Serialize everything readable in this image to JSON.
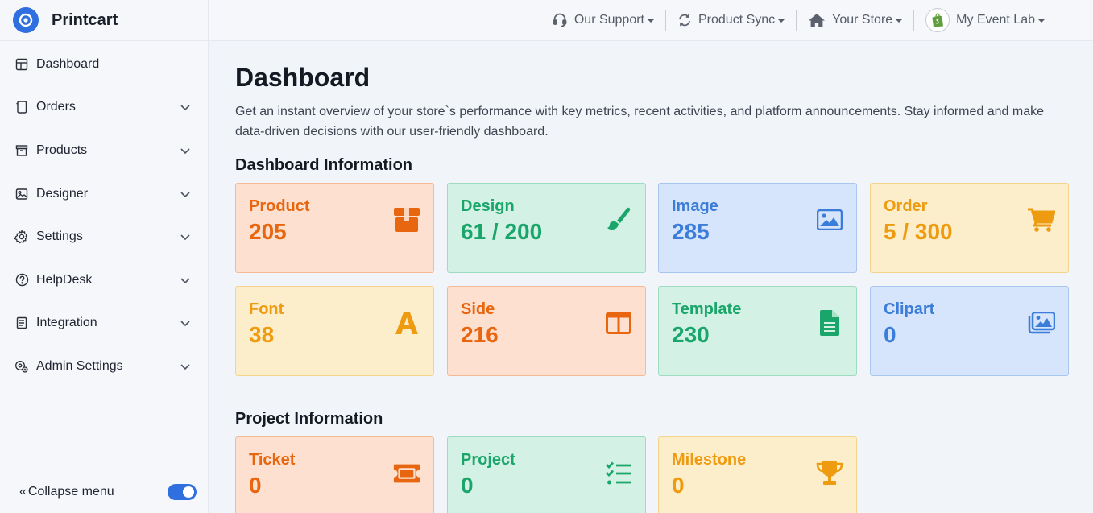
{
  "brand": {
    "name": "Printcart"
  },
  "sidebar": {
    "items": [
      {
        "label": "Dashboard",
        "icon": "layout-icon"
      },
      {
        "label": "Orders",
        "icon": "tablet-icon"
      },
      {
        "label": "Products",
        "icon": "archive-icon"
      },
      {
        "label": "Designer",
        "icon": "image-icon"
      },
      {
        "label": "Settings",
        "icon": "gear-icon"
      },
      {
        "label": "HelpDesk",
        "icon": "question-circle-icon"
      },
      {
        "label": "Integration",
        "icon": "document-icon"
      },
      {
        "label": "Admin Settings",
        "icon": "admin-gear-icon"
      }
    ],
    "collapse_label": "Collapse menu",
    "collapse_prefix": "«"
  },
  "topbar": {
    "support": "Our Support",
    "sync": "Product Sync",
    "store": "Your Store",
    "account": "My Event Lab"
  },
  "main": {
    "title": "Dashboard",
    "description": "Get an instant overview of your store`s performance with key metrics, recent activities, and platform announcements. Stay informed and make data-driven decisions with our user-friendly dashboard.",
    "dashboard_section": "Dashboard Information",
    "project_section": "Project Information",
    "dashboard_cards": [
      {
        "label": "Product",
        "value": "205",
        "icon": "box-icon",
        "color": "#e8660f"
      },
      {
        "label": "Design",
        "value": "61 / 200",
        "icon": "paintbrush-icon",
        "color": "#1aa66a"
      },
      {
        "label": "Image",
        "value": "285",
        "icon": "picture-icon",
        "color": "#3b7dd8"
      },
      {
        "label": "Order",
        "value": "5 / 300",
        "icon": "cart-icon",
        "color": "#ee9b10"
      },
      {
        "label": "Font",
        "value": "38",
        "icon": "letter-a-icon",
        "color": "#ee9b10"
      },
      {
        "label": "Side",
        "value": "216",
        "icon": "columns-icon",
        "color": "#e8660f"
      },
      {
        "label": "Template",
        "value": "230",
        "icon": "file-icon",
        "color": "#1aa66a"
      },
      {
        "label": "Clipart",
        "value": "0",
        "icon": "images-icon",
        "color": "#3b7dd8"
      }
    ],
    "project_cards": [
      {
        "label": "Ticket",
        "value": "0",
        "icon": "ticket-icon",
        "color": "#e8660f"
      },
      {
        "label": "Project",
        "value": "0",
        "icon": "tasks-icon",
        "color": "#1aa66a"
      },
      {
        "label": "Milestone",
        "value": "0",
        "icon": "trophy-icon",
        "color": "#ee9b10"
      }
    ]
  },
  "colors": {
    "accent": "#2f6fe0",
    "orange": "#e8660f",
    "green": "#1aa66a",
    "blue": "#3b7dd8",
    "yellow": "#ee9b10"
  }
}
